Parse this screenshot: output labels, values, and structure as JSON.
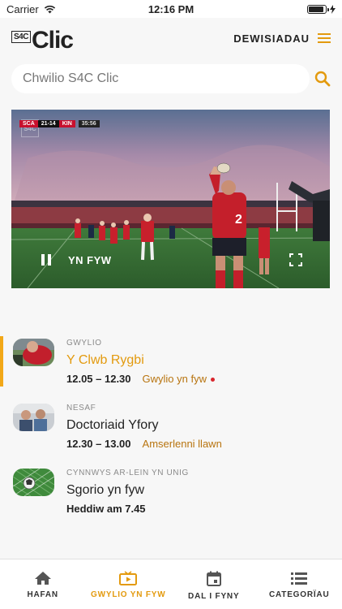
{
  "status_bar": {
    "carrier": "Carrier",
    "time": "12:16 PM",
    "battery_level": 0.9
  },
  "header": {
    "logo_badge": "S4C",
    "logo_text": "Clic",
    "menu_label": "DEWISIADAU"
  },
  "search": {
    "placeholder": "Chwilio S4C Clic"
  },
  "player": {
    "live_label": "YN FYW",
    "scorebug": {
      "home": "SCA",
      "score": "21-14",
      "away": "KIN",
      "clock": "35:56"
    },
    "watermark": "S4C"
  },
  "schedule": [
    {
      "kicker": "GWYLIO",
      "title": "Y Clwb Rygbi",
      "time": "12.05 – 12.30",
      "link": "Gwylio yn fyw"
    },
    {
      "kicker": "NESAF",
      "title": "Doctoriaid Yfory",
      "time": "12.30 – 13.00",
      "link": "Amserlenni llawn"
    },
    {
      "kicker": "CYNNWYS AR-LEIN YN UNIG",
      "title": "Sgorio yn fyw",
      "time": "Heddiw am 7.45",
      "link": ""
    }
  ],
  "nav": [
    {
      "label": "HAFAN",
      "icon": "home-icon"
    },
    {
      "label": "GWYLIO YN FYW",
      "icon": "live-tv-icon"
    },
    {
      "label": "DAL I FYNY",
      "icon": "calendar-icon"
    },
    {
      "label": "CATEGORÏAU",
      "icon": "list-icon"
    }
  ],
  "colors": {
    "accent": "#e39a0e",
    "accent_dark": "#b8740f",
    "live_dot": "#d9262d",
    "scorebug_red": "#c8102e"
  }
}
